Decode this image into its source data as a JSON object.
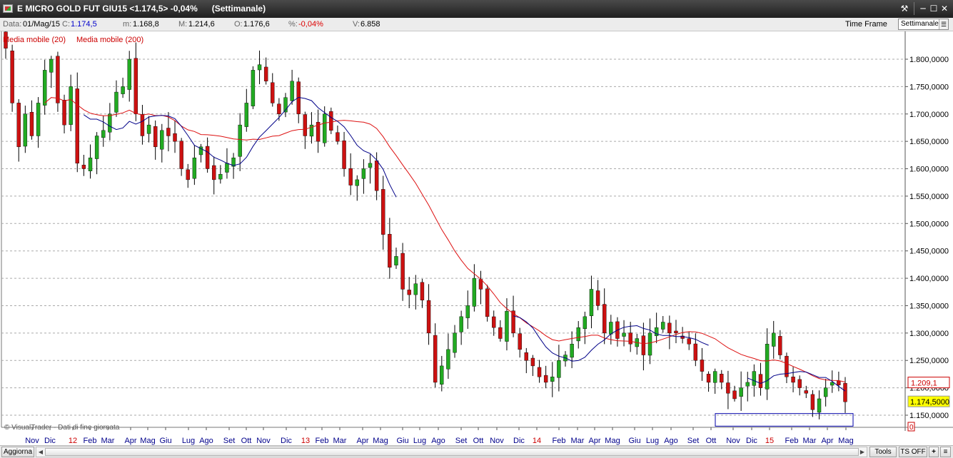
{
  "window": {
    "title": "E MICRO GOLD FUT GIU15 <1.174,5> -0,04%      (Settimanale)",
    "buttons": {
      "tools_icon": "wrench-icon",
      "minimize": "─",
      "maximize": "☐",
      "close": "✕"
    }
  },
  "infobar": {
    "data_label": "Data:",
    "data_value": "01/Mag/15",
    "close_label": "C:",
    "close_value": "1.174,5",
    "min_label": "m:",
    "min_value": "1.168,8",
    "max_label": "M:",
    "max_value": "1.214,6",
    "open_label": "O:",
    "open_value": "1.176,6",
    "pct_label": "%:",
    "pct_value": "-0,04%",
    "vol_label": "V:",
    "vol_value": "6.858",
    "timeframe_label": "Time Frame",
    "timeframe_value": "Settimanale"
  },
  "legend": {
    "ma20": "Media mobile (20)",
    "ma200": "Media mobile (200)"
  },
  "watermark": "© VisualTrader - Dati di fine giornata",
  "colors": {
    "up": "#22aa22",
    "down": "#cc1111",
    "ma20": "#dd1111",
    "ma200": "#000088",
    "grid": "#aaaaaa",
    "highlight_price_bg": "#ffff00",
    "ref_price_border": "#cc0000",
    "zone_box": "#0000aa"
  },
  "chart_data": {
    "type": "candlestick",
    "ylim": [
      1130000,
      1860000
    ],
    "y_ticks": [
      "1.150,0000",
      "1.200,0000",
      "1.250,0000",
      "1.300,0000",
      "1.350,0000",
      "1.400,0000",
      "1.450,0000",
      "1.500,0000",
      "1.550,0000",
      "1.600,0000",
      "1.650,0000",
      "1.700,0000",
      "1.750,0000",
      "1.800,0000"
    ],
    "x_ticks": [
      "Nov",
      "Dic",
      "12",
      "Feb",
      "Mar",
      "Apr",
      "Mag",
      "Giu",
      "Lug",
      "Ago",
      "Set",
      "Ott",
      "Nov",
      "Dic",
      "13",
      "Feb",
      "Mar",
      "Apr",
      "Mag",
      "Giu",
      "Lug",
      "Ago",
      "Set",
      "Ott",
      "Nov",
      "Dic",
      "14",
      "Feb",
      "Mar",
      "Apr",
      "Mag",
      "Giu",
      "Lug",
      "Ago",
      "Set",
      "Ott",
      "Nov",
      "Dic",
      "15",
      "Feb",
      "Mar",
      "Apr",
      "Mag"
    ],
    "x_ticks_red": [
      "12",
      "13",
      "14",
      "15"
    ],
    "price_label_ref": "1.209,1",
    "price_label_last": "1.174,5000",
    "sub_panel_value": "0",
    "close_path": [
      1820000,
      1720000,
      1640000,
      1700000,
      1660000,
      1720000,
      1780000,
      1800000,
      1720000,
      1680000,
      1750000,
      1610000,
      1600000,
      1620000,
      1660000,
      1670000,
      1700000,
      1740000,
      1750000,
      1800000,
      1700000,
      1660000,
      1680000,
      1640000,
      1670000,
      1660000,
      1650000,
      1600000,
      1580000,
      1620000,
      1640000,
      1600000,
      1580000,
      1590000,
      1610000,
      1620000,
      1680000,
      1720000,
      1780000,
      1790000,
      1760000,
      1720000,
      1700000,
      1730000,
      1760000,
      1700000,
      1660000,
      1680000,
      1650000,
      1700000,
      1670000,
      1650000,
      1600000,
      1570000,
      1580000,
      1600000,
      1610000,
      1560000,
      1480000,
      1420000,
      1440000,
      1380000,
      1370000,
      1390000,
      1360000,
      1300000,
      1210000,
      1240000,
      1270000,
      1300000,
      1330000,
      1350000,
      1400000,
      1380000,
      1330000,
      1310000,
      1290000,
      1340000,
      1300000,
      1270000,
      1250000,
      1240000,
      1220000,
      1210000,
      1220000,
      1250000,
      1260000,
      1280000,
      1310000,
      1330000,
      1380000,
      1350000,
      1300000,
      1320000,
      1290000,
      1300000,
      1280000,
      1290000,
      1260000,
      1300000,
      1310000,
      1320000,
      1300000,
      1300000,
      1290000,
      1280000,
      1250000,
      1230000,
      1210000,
      1230000,
      1210000,
      1190000,
      1180000,
      1200000,
      1210000,
      1230000,
      1200000,
      1280000,
      1300000,
      1260000,
      1220000,
      1210000,
      1200000,
      1190000,
      1160000,
      1180000,
      1200000,
      1210000,
      1205000,
      1174500
    ],
    "ma20_path": [
      [
        9,
        12
      ],
      [
        60,
        0
      ],
      [
        100,
        0
      ],
      [
        130,
        8
      ],
      [
        160,
        12
      ],
      [
        200,
        14
      ],
      [
        230,
        14
      ],
      [
        270,
        18
      ],
      [
        300,
        22
      ],
      [
        340,
        15
      ],
      [
        380,
        10
      ],
      [
        420,
        5
      ],
      [
        460,
        8
      ],
      [
        500,
        20
      ],
      [
        540,
        40
      ],
      [
        580,
        60
      ],
      [
        620,
        80
      ],
      [
        660,
        85
      ],
      [
        700,
        90
      ],
      [
        740,
        95
      ],
      [
        780,
        100
      ],
      [
        820,
        98
      ],
      [
        860,
        97
      ],
      [
        900,
        96
      ],
      [
        940,
        97
      ],
      [
        980,
        98
      ],
      [
        1020,
        99
      ],
      [
        1060,
        100
      ],
      [
        1100,
        100
      ],
      [
        1140,
        100
      ],
      [
        1185,
        100
      ]
    ],
    "ma200_range": [
      120,
      1185
    ]
  },
  "bottombar": {
    "refresh": "Aggiorna",
    "tools": "Tools",
    "ts": "TS OFF",
    "plus": "+",
    "menu": "≡"
  }
}
